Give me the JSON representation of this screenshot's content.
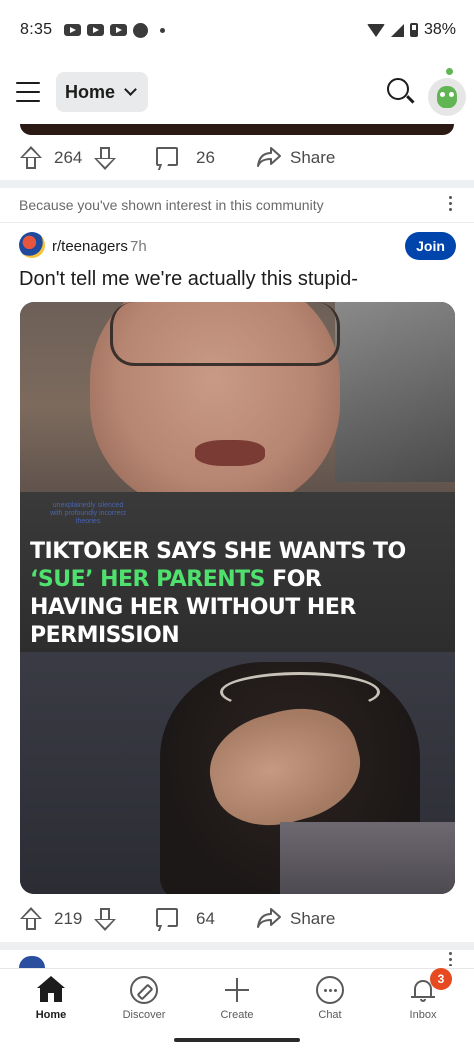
{
  "status_bar": {
    "time": "8:35",
    "battery": "38%"
  },
  "top_nav": {
    "feed_selector": "Home"
  },
  "previous_post": {
    "upvotes": "264",
    "comments": "26",
    "share_label": "Share"
  },
  "post": {
    "recommendation": "Because you've shown interest in this community",
    "community": "r/teenagers",
    "age": "7h",
    "join_label": "Join",
    "title": "Don't tell me we're actually this stupid-",
    "image": {
      "watermark": "unexplainedly silenced with profoundly incorrect theories",
      "headline_line1": "TIKTOKER SAYS SHE WANTS TO",
      "headline_highlight": "‘SUE’ HER PARENTS",
      "headline_line2_rest": " FOR",
      "headline_line3": "HAVING HER WITHOUT HER",
      "headline_line4": "PERMISSION"
    },
    "upvotes": "219",
    "comments": "64",
    "share_label": "Share"
  },
  "bottom_nav": {
    "items": [
      {
        "label": "Home",
        "icon": "home-icon"
      },
      {
        "label": "Discover",
        "icon": "compass-icon"
      },
      {
        "label": "Create",
        "icon": "plus-icon"
      },
      {
        "label": "Chat",
        "icon": "chat-icon"
      },
      {
        "label": "Inbox",
        "icon": "bell-icon"
      }
    ],
    "inbox_badge": "3"
  },
  "colors": {
    "join_button": "#0045ac",
    "badge": "#e54a20",
    "headline_highlight": "#4fe06d"
  }
}
